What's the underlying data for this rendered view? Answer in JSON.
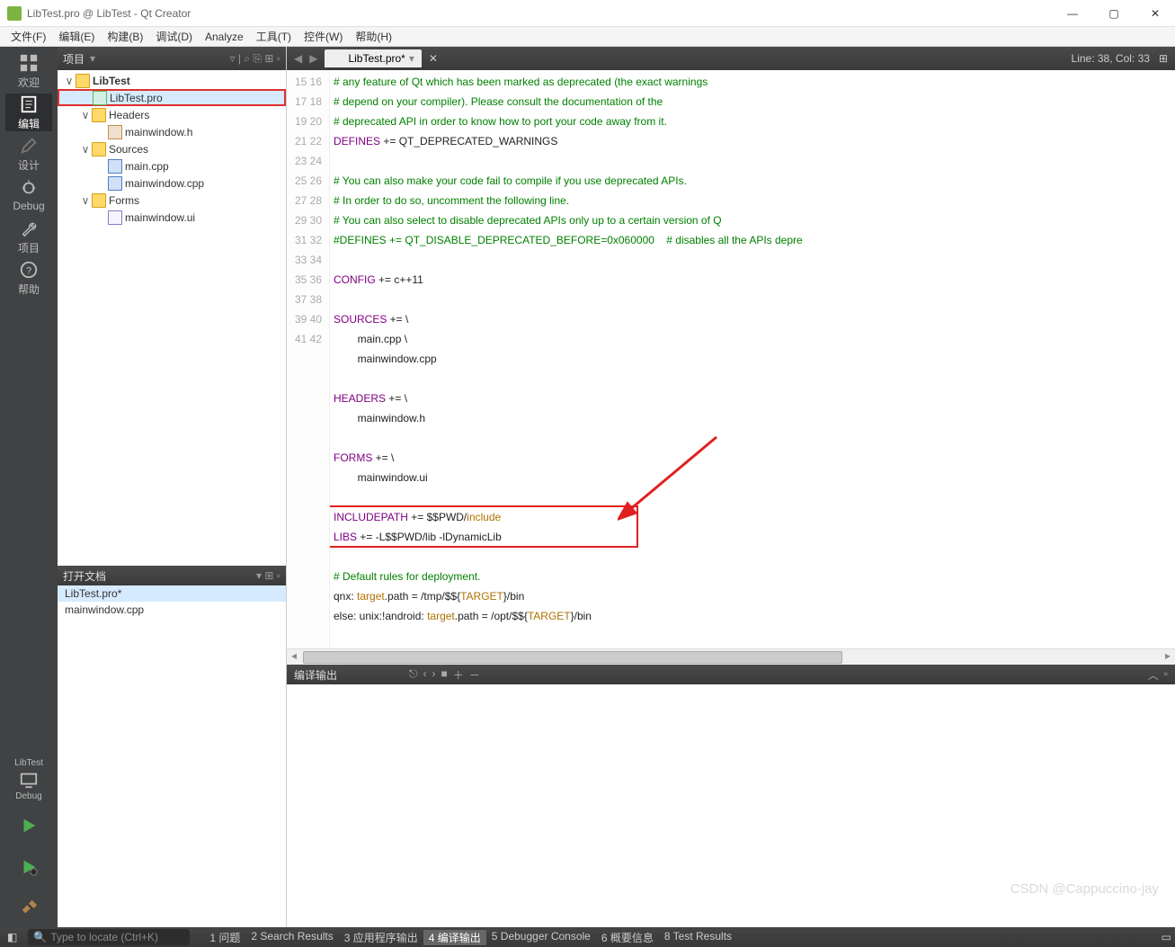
{
  "window": {
    "title": "LibTest.pro @ LibTest - Qt Creator"
  },
  "menu": [
    "文件(F)",
    "编辑(E)",
    "构建(B)",
    "调试(D)",
    "Analyze",
    "工具(T)",
    "控件(W)",
    "帮助(H)"
  ],
  "leftbar": {
    "items": [
      {
        "label": "欢迎"
      },
      {
        "label": "编辑"
      },
      {
        "label": "设计"
      },
      {
        "label": "Debug"
      },
      {
        "label": "项目"
      },
      {
        "label": "帮助"
      }
    ],
    "bottom": [
      {
        "label": "LibTest"
      },
      {
        "label": "Debug"
      }
    ]
  },
  "project_panel": {
    "title": "项目",
    "tree": [
      {
        "d": 0,
        "exp": "∨",
        "icon": "fld",
        "label": "LibTest",
        "bold": true
      },
      {
        "d": 1,
        "exp": "",
        "icon": "file-pro",
        "label": "LibTest.pro",
        "sel": true
      },
      {
        "d": 1,
        "exp": "∨",
        "icon": "fld",
        "label": "Headers"
      },
      {
        "d": 2,
        "exp": "",
        "icon": "file-h",
        "label": "mainwindow.h"
      },
      {
        "d": 1,
        "exp": "∨",
        "icon": "fld",
        "label": "Sources"
      },
      {
        "d": 2,
        "exp": "",
        "icon": "file-cpp",
        "label": "main.cpp"
      },
      {
        "d": 2,
        "exp": "",
        "icon": "file-cpp",
        "label": "mainwindow.cpp"
      },
      {
        "d": 1,
        "exp": "∨",
        "icon": "fld",
        "label": "Forms"
      },
      {
        "d": 2,
        "exp": "",
        "icon": "file-ui",
        "label": "mainwindow.ui"
      }
    ]
  },
  "open_docs": {
    "title": "打开文档",
    "items": [
      "LibTest.pro*",
      "mainwindow.cpp"
    ]
  },
  "editor": {
    "tab": "LibTest.pro*",
    "cursor": "Line: 38, Col: 33",
    "first_line": 15,
    "lines": [
      {
        "t": "# any feature of Qt which has been marked as deprecated (the exact warnings",
        "cls": "c-comment"
      },
      {
        "t": "# depend on your compiler). Please consult the documentation of the",
        "cls": "c-comment"
      },
      {
        "t": "# deprecated API in order to know how to port your code away from it.",
        "cls": "c-comment"
      },
      {
        "html": "<span class='c-keyword'>DEFINES</span> += QT_DEPRECATED_WARNINGS"
      },
      {
        "t": ""
      },
      {
        "t": "# You can also make your code fail to compile if you use deprecated APIs.",
        "cls": "c-comment"
      },
      {
        "t": "# In order to do so, uncomment the following line.",
        "cls": "c-comment"
      },
      {
        "t": "# You can also select to disable deprecated APIs only up to a certain version of Q",
        "cls": "c-comment"
      },
      {
        "t": "#DEFINES += QT_DISABLE_DEPRECATED_BEFORE=0x060000    # disables all the APIs depre",
        "cls": "c-comment"
      },
      {
        "t": ""
      },
      {
        "html": "<span class='c-keyword'>CONFIG</span> += c++11"
      },
      {
        "t": ""
      },
      {
        "html": "<span class='c-keyword'>SOURCES</span> += \\"
      },
      {
        "t": "        main.cpp \\"
      },
      {
        "t": "        mainwindow.cpp"
      },
      {
        "t": ""
      },
      {
        "html": "<span class='c-keyword'>HEADERS</span> += \\"
      },
      {
        "t": "        mainwindow.h"
      },
      {
        "t": ""
      },
      {
        "html": "<span class='c-keyword'>FORMS</span> += \\"
      },
      {
        "t": "        mainwindow.ui"
      },
      {
        "t": ""
      },
      {
        "html": "<span class='c-keyword'>INCLUDEPATH</span> += $$PWD/<span class='c-var'>include</span>"
      },
      {
        "html": "<span class='c-keyword'>LIBS</span> += -L$$PWD/lib -lDynamicLib"
      },
      {
        "t": ""
      },
      {
        "t": "# Default rules for deployment.",
        "cls": "c-comment"
      },
      {
        "html": "qnx: <span class='c-var'>target</span>.path = /tmp/$${<span class='c-var'>TARGET</span>}/bin"
      },
      {
        "html": "else: unix:!android: <span class='c-var'>target</span>.path = /opt/$${<span class='c-var'>TARGET</span>}/bin"
      }
    ]
  },
  "output_panel": {
    "title": "编译输出"
  },
  "statusbar": {
    "search_placeholder": "Type to locate (Ctrl+K)",
    "tabs": [
      "1  问题",
      "2  Search Results",
      "3  应用程序输出",
      "4  编译输出",
      "5  Debugger Console",
      "6  概要信息",
      "8  Test Results"
    ]
  },
  "watermark": "CSDN @Cappuccino-jay"
}
